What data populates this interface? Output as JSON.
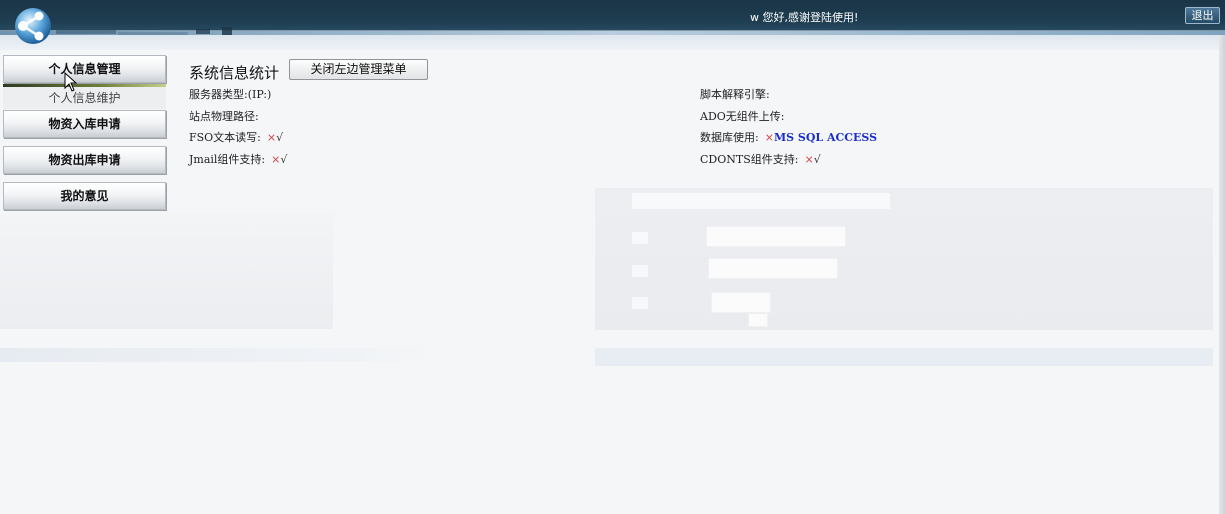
{
  "header": {
    "welcome_text": "w 您好,感谢登陆使用!",
    "logout_label": "退出"
  },
  "sidebar": {
    "items": [
      {
        "label": "个人信息管理",
        "active": true,
        "subitems": [
          "个人信息维护"
        ]
      },
      {
        "label": "物资入库申请"
      },
      {
        "label": "物资出库申请"
      },
      {
        "label": "我的意见"
      }
    ]
  },
  "main": {
    "title": "系统信息统计",
    "close_menu_label": "关闭左边管理菜单",
    "info": {
      "server_type_label": "服务器类型:(IP:)",
      "script_engine_label": "脚本解释引擎:",
      "site_path_label": "站点物理路径:",
      "ado_upload_label": "ADO无组件上传:",
      "fso_label": "FSO文本读写:",
      "fso_x": "×",
      "fso_ok": "√",
      "db_label": "数据库使用:",
      "db_x": "×",
      "db_value": "MS SQL ACCESS",
      "jmail_label": "Jmail组件支持:",
      "jmail_x": "×",
      "jmail_ok": "√",
      "cdonts_label": "CDONTS组件支持:",
      "cdonts_x": "×",
      "cdonts_ok": "√"
    }
  },
  "colors": {
    "header_bg": "#1f3e52",
    "cross_mark": "#d23b3b",
    "db_value": "#1a2ec9"
  }
}
